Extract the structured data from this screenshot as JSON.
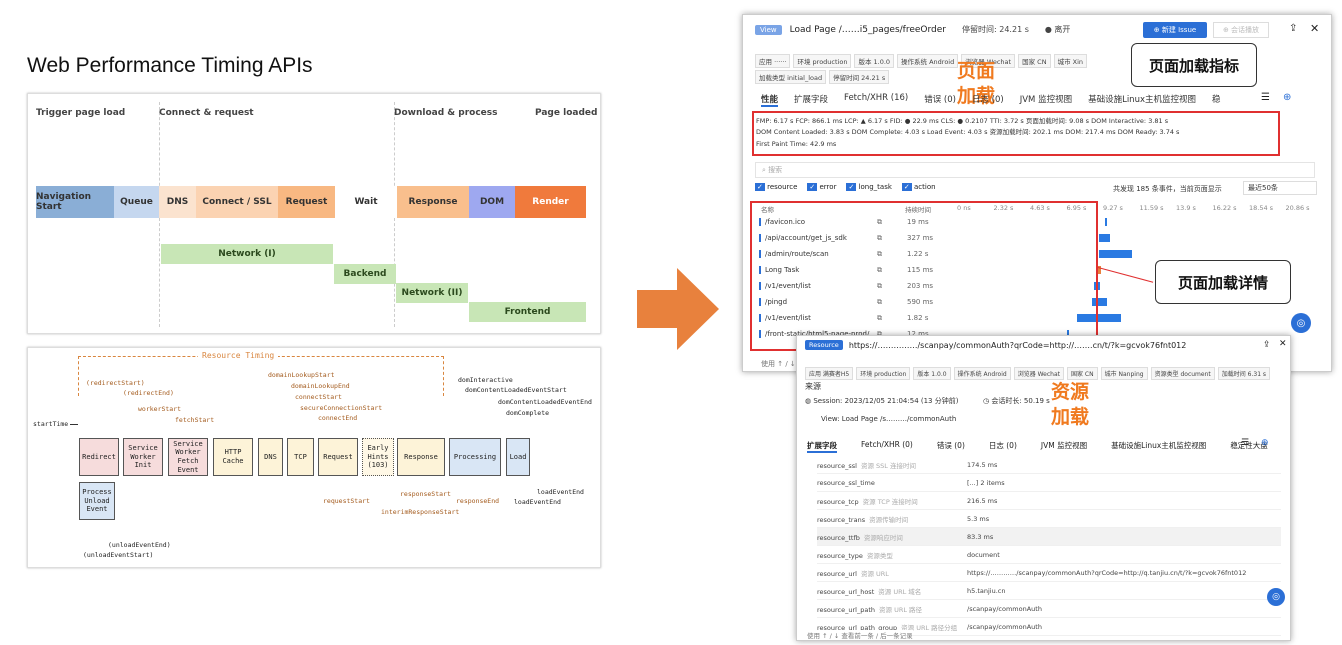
{
  "main_title": "Web Performance Timing APIs",
  "timeline": {
    "phases": [
      "Trigger page load",
      "Connect & request",
      "Download & process",
      "Page loaded"
    ],
    "segments": [
      {
        "label": "Navigation Start",
        "color": "#8aaed6"
      },
      {
        "label": "Queue",
        "color": "#c5d7ef"
      },
      {
        "label": "DNS",
        "color": "#fbe3cf"
      },
      {
        "label": "Connect / SSL",
        "color": "#fbd3b2"
      },
      {
        "label": "Request",
        "color": "#f8b882"
      },
      {
        "label": "Wait",
        "color": "#ffffff"
      },
      {
        "label": "Response",
        "color": "#f9bf8d"
      },
      {
        "label": "DOM",
        "color": "#9ea8f0"
      },
      {
        "label": "Render",
        "color": "#f07a3c"
      }
    ],
    "network": [
      "Network (I)",
      "Backend",
      "Network (II)",
      "Frontend"
    ]
  },
  "resource_timing": {
    "title": "Resource Timing",
    "boxes": [
      "Redirect",
      "Service Worker Init",
      "Service Worker Fetch Event",
      "HTTP Cache",
      "DNS",
      "TCP",
      "Request",
      "Early Hints (103)",
      "Response",
      "Processing",
      "Load",
      "Process Unload Event"
    ],
    "events_top": [
      "(redirectStart)",
      "(redirectEnd)",
      "workerStart",
      "fetchStart",
      "domainLookupStart",
      "domainLookupEnd",
      "connectStart",
      "secureConnectionStart",
      "connectEnd",
      "domInteractive",
      "domContentLoadedEventStart",
      "domContentLoadedEventEnd",
      "domComplete"
    ],
    "events_bottom": [
      "requestStart",
      "interimResponseStart",
      "responseStart",
      "responseEnd",
      "loadEventEnd",
      "loadEventEnd",
      "(unloadEventEnd)",
      "(unloadEventStart)"
    ],
    "start": "startTime"
  },
  "win1": {
    "badge": "View",
    "title": "Load Page /……i5_pages/freeOrder",
    "stay_label": "停留时间: 24.21 s",
    "status": "● 离开",
    "new_issue": "⊕ 新建 Issue",
    "share": "⊕ 会话播放",
    "tags": [
      "应用  ······",
      "环境  production",
      "版本  1.0.0",
      "操作系统  Android",
      "浏览器  Wechat",
      "国家  CN",
      "城市  Xin"
    ],
    "tags2": [
      "加载类型  initial_load",
      "停留时间  24.21 s"
    ],
    "tabs": [
      "性能",
      "扩展字段",
      "Fetch/XHR (16)",
      "错误 (0)",
      "日志 (0)",
      "JVM 监控视图",
      "基础设施Linux主机监控视图",
      "稳"
    ],
    "metrics1": "FMP: 6.17 s   FCP: 866.1 ms   LCP: ▲ 6.17 s   FID: ● 22.9 ms   CLS: ● 0.2107   TTI: 3.72 s   页面加载时间: 9.08 s   DOM Interactive: 3.81 s",
    "metrics2": "DOM Content Loaded: 3.83 s   DOM Complete: 4.03 s   Load Event: 4.03 s   资源加载时间: 202.1 ms   DOM: 217.4 ms   DOM Ready: 3.74 s",
    "metrics3": "First Paint Time: 42.9 ms",
    "search": "搜索",
    "filters": [
      "resource",
      "error",
      "long_task",
      "action"
    ],
    "summary": "共发现 185 条事件，当前页面显示",
    "select": "最近50条",
    "head_name": "名称",
    "head_dur": "持续时间",
    "axis": [
      "0 ns",
      "2.32 s",
      "4.63 s",
      "6.95 s",
      "9.27 s",
      "11.59 s",
      "13.9 s",
      "16.22 s",
      "18.54 s",
      "20.86 s"
    ],
    "rows": [
      {
        "name": "/favicon.ico",
        "dur": "19 ms",
        "start": 0.405,
        "w": 0.004
      },
      {
        "name": "/api/account/get_js_sdk",
        "dur": "327 ms",
        "start": 0.39,
        "w": 0.03
      },
      {
        "name": "/admin/route/scan",
        "dur": "1.22 s",
        "start": 0.39,
        "w": 0.09
      },
      {
        "name": "Long Task",
        "dur": "115 ms",
        "start": 0.385,
        "w": 0.01
      },
      {
        "name": "/v1/event/list",
        "dur": "203 ms",
        "start": 0.375,
        "w": 0.018
      },
      {
        "name": "/pingd",
        "dur": "590 ms",
        "start": 0.37,
        "w": 0.04
      },
      {
        "name": "/v1/event/list",
        "dur": "1.82 s",
        "start": 0.33,
        "w": 0.12
      },
      {
        "name": "/front-static/html5-page-prod/",
        "dur": "12 ms",
        "start": 0.3,
        "w": 0.003
      }
    ],
    "callout1": "页面加载指标",
    "callout2": "页面加载详情",
    "big1a": "页面",
    "big1b": "加载",
    "footer": "使用  ↑ / ↓"
  },
  "win2": {
    "badge": "Resource",
    "url": "https://……………/scanpay/commonAuth?qrCode=http://…….cn/t/?k=gcvok76fnt012",
    "tags": [
      "应用  满赛者H5",
      "环境  production",
      "版本  1.0.0",
      "操作系统  Android",
      "浏览器  Wechat",
      "国家  CN",
      "城市  Nanping",
      "资源类型  document",
      "加载时间  6.31 s"
    ],
    "source": "来源",
    "session": "Session:  2023/12/05 21:04:54  (13 分钟前)",
    "session_len": "◷ 会话时长: 50.19 s",
    "view": "View:  Load Page /s………/commonAuth",
    "big2a": "资源",
    "big2b": "加载",
    "tabs": [
      "扩展字段",
      "Fetch/XHR (0)",
      "错误 (0)",
      "日志 (0)",
      "JVM 监控视图",
      "基础设施Linux主机监控视图",
      "稳定性大盘"
    ],
    "kv": [
      {
        "k": "resource_ssl",
        "d": "资源 SSL 连接时间",
        "v": "174.5 ms"
      },
      {
        "k": "resource_ssl_time",
        "d": "",
        "v": "[...] 2 items"
      },
      {
        "k": "resource_tcp",
        "d": "资源 TCP 连接时间",
        "v": "216.5 ms"
      },
      {
        "k": "resource_trans",
        "d": "资源传输时间",
        "v": "5.3 ms"
      },
      {
        "k": "resource_ttfb",
        "d": "资源响应时间",
        "v": "83.3 ms"
      },
      {
        "k": "resource_type",
        "d": "资源类型",
        "v": "document"
      },
      {
        "k": "resource_url",
        "d": "资源 URL",
        "v": "https://…………/scanpay/commonAuth?qrCode=http://q.tanjiu.cn/t/?k=gcvok76fnt012"
      },
      {
        "k": "resource_url_host",
        "d": "资源 URL 域名",
        "v": "h5.tanjiu.cn"
      },
      {
        "k": "resource_url_path",
        "d": "资源 URL 路径",
        "v": "/scanpay/commonAuth"
      },
      {
        "k": "resource_url_path_group",
        "d": "资源 URL 路径分组",
        "v": "/scanpay/commonAuth"
      }
    ],
    "footer": "使用  ↑ / ↓  查看前一条 / 后一条记录"
  }
}
